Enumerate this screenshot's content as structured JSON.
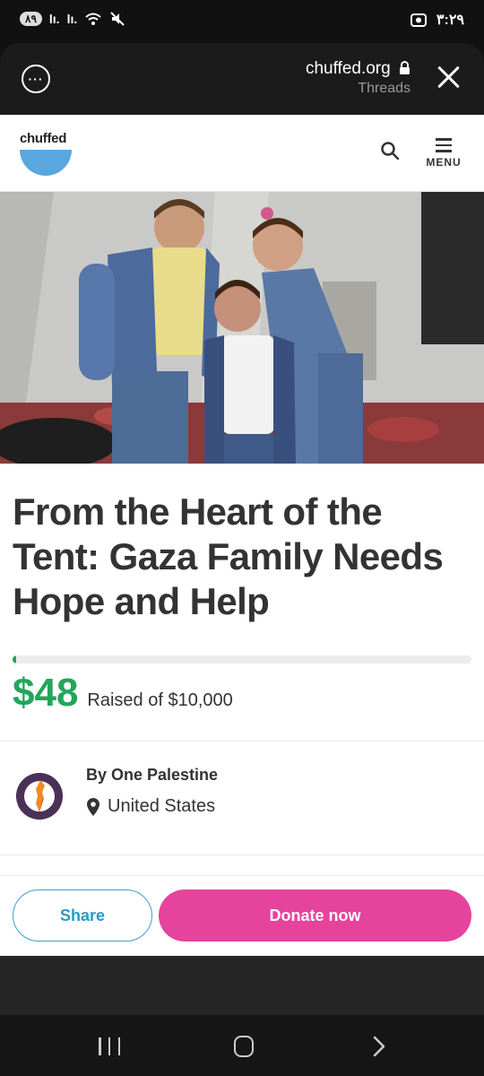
{
  "status_bar": {
    "battery": "٨٩",
    "signal_1": "lı.",
    "signal_2": "lı.",
    "time": "٣:٢٩"
  },
  "browser": {
    "domain": "chuffed.org",
    "referrer": "Threads",
    "more_label": "···"
  },
  "site": {
    "logo_text": "chuffed",
    "logo_color": "#5aa7e0",
    "menu_label": "MENU"
  },
  "campaign": {
    "title": "From the Heart of the Tent: Gaza Family Needs Hope and Help",
    "raised_amount": "$48",
    "raised_of": "Raised of $10,000",
    "progress_fraction": 0.0048,
    "organizer": "By One Palestine",
    "location": "United States"
  },
  "actions": {
    "share_label": "Share",
    "donate_label": "Donate now"
  },
  "colors": {
    "accent_green": "#23a65a",
    "donate_pink": "#e5439c",
    "share_blue": "#2a99c9"
  },
  "icons": {
    "search": "search-icon",
    "menu": "hamburger-icon",
    "location": "map-pin-icon",
    "close": "close-icon",
    "lock": "lock-icon"
  }
}
